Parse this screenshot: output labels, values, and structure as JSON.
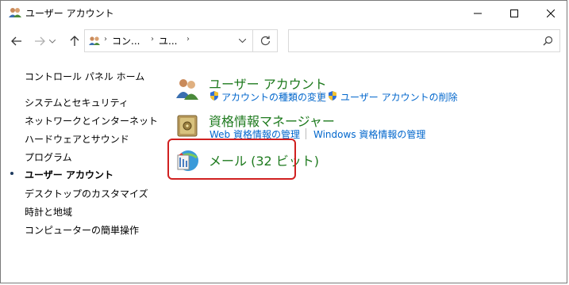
{
  "window": {
    "title": "ユーザー アカウント"
  },
  "titlebar": {
    "min_icon": "minimize-icon",
    "max_icon": "maximize-icon",
    "close_icon": "close-icon"
  },
  "address": {
    "crumbs": [
      "コン...",
      "ユ..."
    ],
    "search_placeholder": ""
  },
  "sidebar": {
    "items": [
      {
        "label": "コントロール パネル ホーム",
        "active": false
      },
      {
        "label": "システムとセキュリティ",
        "active": false
      },
      {
        "label": "ネットワークとインターネット",
        "active": false
      },
      {
        "label": "ハードウェアとサウンド",
        "active": false
      },
      {
        "label": "プログラム",
        "active": false
      },
      {
        "label": "ユーザー アカウント",
        "active": true
      },
      {
        "label": "デスクトップのカスタマイズ",
        "active": false
      },
      {
        "label": "時計と地域",
        "active": false
      },
      {
        "label": "コンピューターの簡単操作",
        "active": false
      }
    ]
  },
  "main": {
    "categories": [
      {
        "title": "ユーザー アカウント",
        "icon": "users-icon",
        "links": [
          "アカウントの種類の変更",
          "ユーザー アカウントの削除"
        ]
      },
      {
        "title": "資格情報マネージャー",
        "icon": "credential-vault-icon",
        "links": [
          "Web 資格情報の管理",
          "Windows 資格情報の管理"
        ]
      },
      {
        "title": "メール (32 ビット)",
        "icon": "mail-icon",
        "links": []
      }
    ]
  },
  "colors": {
    "category_title": "#1e7a1e",
    "link": "#0066cc",
    "highlight": "#d02020"
  }
}
